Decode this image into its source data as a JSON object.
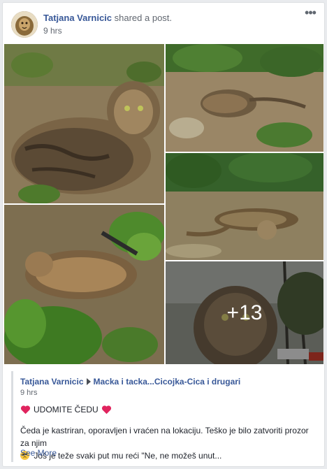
{
  "post": {
    "author": "Tatjana Varnicic",
    "action": " shared a post.",
    "time": "9 hrs",
    "more_icon": "more-horizontal-icon",
    "more_glyph": "•••"
  },
  "photos": {
    "more_count_label": "+13"
  },
  "shared": {
    "author": "Tatjana Varnicic",
    "group": "Macka i tacka...Cicojka-Cica i drugari",
    "time": "9 hrs",
    "title": "UDOMITE ČEDU",
    "text_line1": "Čeda je kastriran, oporavljen i vraćen na lokaciju. Teško je bilo zatvoriti prozor za njim",
    "text_line2": " Još je teže svaki put mu reći \"Ne, ne možeš unut...",
    "see_more": "See More",
    "heart_color": "#e0245e"
  },
  "colors": {
    "link": "#385898",
    "meta": "#616770"
  }
}
